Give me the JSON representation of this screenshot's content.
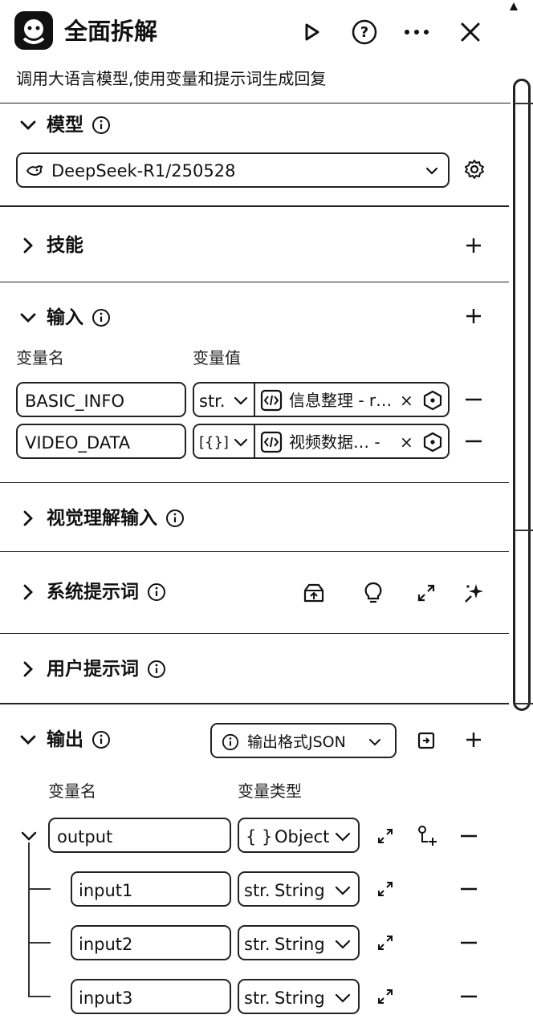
{
  "header": {
    "title": "全面拆解",
    "description": "调用大语言模型,使用变量和提示词生成回复"
  },
  "model": {
    "section_title": "模型",
    "selected": "DeepSeek-R1/250528"
  },
  "skills": {
    "section_title": "技能"
  },
  "inputs": {
    "section_title": "输入",
    "col_name": "变量名",
    "col_value": "变量值",
    "rows": [
      {
        "name": "BASIC_INFO",
        "type": "str.",
        "value": "信息整理 - r…",
        "close": "×"
      },
      {
        "name": "VIDEO_DATA",
        "type": "[{}]",
        "value": "视频数据… -",
        "close": "×"
      }
    ]
  },
  "vision": {
    "section_title": "视觉理解输入"
  },
  "system_prompt": {
    "section_title": "系统提示词"
  },
  "user_prompt": {
    "section_title": "用户提示词"
  },
  "output": {
    "section_title": "输出",
    "format_button": "输出格式JSON",
    "col_name": "变量名",
    "col_type": "变量类型",
    "rows": [
      {
        "name": "output",
        "type_prefix": "{ }",
        "type": "Object"
      },
      {
        "name": "input1",
        "type_prefix": "str.",
        "type": "String"
      },
      {
        "name": "input2",
        "type_prefix": "str.",
        "type": "String"
      },
      {
        "name": "input3",
        "type_prefix": "str.",
        "type": "String"
      }
    ]
  }
}
